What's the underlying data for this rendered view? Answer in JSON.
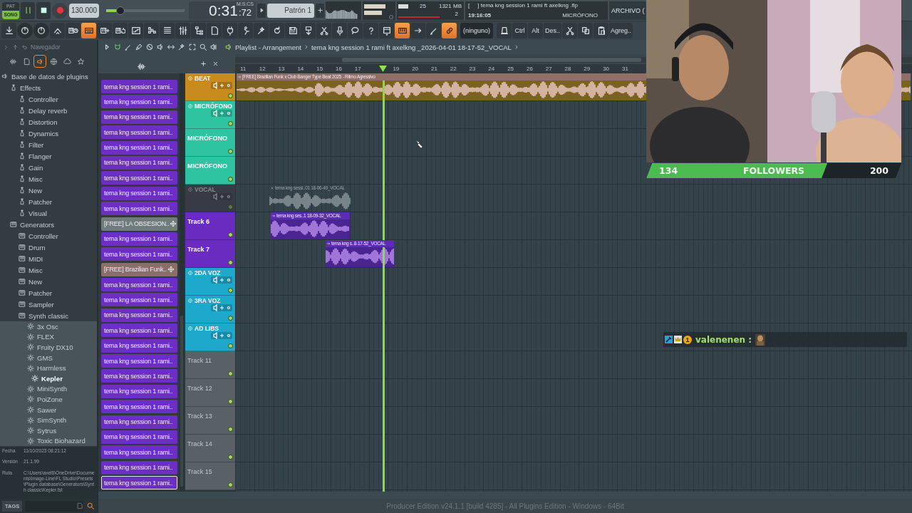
{
  "transport": {
    "modes": [
      {
        "label": "PAT",
        "selected": false
      },
      {
        "label": "SONG",
        "selected": true
      }
    ],
    "tempo": "130.000",
    "master_volume": {
      "level": 0.18
    },
    "time": "0:31",
    "time_fraction": ":72",
    "time_unit": "M:S:CS",
    "pattern": "Patrón 1",
    "cpu": "25",
    "memory": "1321 MB",
    "polyphony": "2",
    "hint": {
      "title": "[     ] tema kng session 1 rami ft axelkng .flp",
      "clock": "19:16:05",
      "channel": "MICRÓFONO"
    },
    "menu": "ARCHIVO ("
  },
  "toolbar": [
    {
      "kind": "download",
      "on": false
    },
    {
      "kind": "knob",
      "on": false
    },
    {
      "kind": "knob",
      "on": false
    },
    {
      "kind": "arrows",
      "on": false
    },
    {
      "kind": "piano-clock",
      "on": false
    },
    {
      "kind": "typing",
      "on": true
    },
    {
      "kind": "piano-plus",
      "on": false
    },
    {
      "kind": "piano-loop",
      "on": false
    },
    {
      "kind": "roll",
      "on": false
    },
    {
      "kind": "steps",
      "on": false
    },
    {
      "kind": "rows",
      "on": false
    },
    {
      "kind": "mixer",
      "on": false
    },
    {
      "kind": "tree",
      "on": false
    },
    {
      "kind": "file",
      "on": false
    },
    {
      "kind": "plug",
      "on": false
    },
    {
      "kind": "person",
      "on": false
    },
    {
      "kind": "wand",
      "on": false
    },
    {
      "kind": "refresh",
      "on": false
    },
    {
      "kind": "save",
      "on": false
    },
    {
      "kind": "save-mix",
      "on": false
    },
    {
      "kind": "scissors",
      "on": false
    },
    {
      "kind": "mic",
      "on": false
    },
    {
      "kind": "chat",
      "on": false
    },
    {
      "kind": "help",
      "on": false
    },
    {
      "kind": "window",
      "on": false
    },
    {
      "kind": "piano",
      "on": true
    },
    {
      "kind": "arrow",
      "on": false
    },
    {
      "kind": "pen",
      "on": false
    },
    {
      "kind": "link",
      "on": true
    },
    {
      "kind": "field",
      "label": "(ninguno)",
      "on": false
    },
    {
      "kind": "hat",
      "on": false
    },
    {
      "kind": "text",
      "label": "Ctrl",
      "on": false
    },
    {
      "kind": "text",
      "label": "Alt",
      "on": false
    },
    {
      "kind": "text",
      "label": "Des..",
      "on": false
    },
    {
      "kind": "scissors",
      "on": false
    },
    {
      "kind": "copy",
      "on": false
    },
    {
      "kind": "paste",
      "on": false
    },
    {
      "kind": "text",
      "label": "Agreg..",
      "on": false
    }
  ],
  "browser": {
    "title": "Navegador",
    "tabs": [
      {
        "kind": "wave",
        "selected": false
      },
      {
        "kind": "file",
        "selected": false
      },
      {
        "kind": "speaker",
        "selected": true
      },
      {
        "kind": "globe",
        "selected": false
      },
      {
        "kind": "cloud",
        "selected": false
      },
      {
        "kind": "star",
        "selected": false
      }
    ],
    "tree": [
      {
        "label": "Base de datos de plugins",
        "selected": false,
        "children": [
          {
            "label": "Effects",
            "selected": false,
            "children": [
              {
                "label": "Controller",
                "selected": false
              },
              {
                "label": "Delay reverb",
                "selected": false
              },
              {
                "label": "Distortion",
                "selected": false
              },
              {
                "label": "Dynamics",
                "selected": false
              },
              {
                "label": "Filter",
                "selected": false
              },
              {
                "label": "Flanger",
                "selected": false
              },
              {
                "label": "Gain",
                "selected": false
              },
              {
                "label": "Misc",
                "selected": false
              },
              {
                "label": "New",
                "selected": false
              },
              {
                "label": "Patcher",
                "selected": false
              },
              {
                "label": "Visual",
                "selected": false
              }
            ]
          },
          {
            "label": "Generators",
            "selected": false,
            "children": [
              {
                "label": "Controller",
                "selected": false
              },
              {
                "label": "Drum",
                "selected": false
              },
              {
                "label": "MIDI",
                "selected": false
              },
              {
                "label": "Misc",
                "selected": false
              },
              {
                "label": "New",
                "selected": false
              },
              {
                "label": "Patcher",
                "selected": false
              },
              {
                "label": "Sampler",
                "selected": false
              },
              {
                "label": "Synth classic",
                "selected": false,
                "children": [
                  {
                    "label": "3x Osc",
                    "selected": false
                  },
                  {
                    "label": "FLEX",
                    "selected": false
                  },
                  {
                    "label": "Fruity DX10",
                    "selected": false
                  },
                  {
                    "label": "GMS",
                    "selected": false
                  },
                  {
                    "label": "Harmless",
                    "selected": false
                  },
                  {
                    "label": "Kepler",
                    "selected": true
                  },
                  {
                    "label": "MiniSynth",
                    "selected": false
                  },
                  {
                    "label": "PoiZone",
                    "selected": false
                  },
                  {
                    "label": "Sawer",
                    "selected": false
                  },
                  {
                    "label": "SimSynth",
                    "selected": false
                  },
                  {
                    "label": "Sytrus",
                    "selected": false
                  },
                  {
                    "label": "Toxic Biohazard",
                    "selected": false
                  }
                ]
              }
            ]
          }
        ]
      }
    ],
    "info": [
      {
        "label": "Fecha",
        "value": "11/10/2023 08:21:12"
      },
      {
        "label": "Versión",
        "value": "21.1.99"
      },
      {
        "label": "Ruta",
        "value": "C:\\Users\\axel6\\OneDrive\\Documents\\Image-Line\\FL Studio\\Presets\\Plugin database\\Generators\\Synth classic\\Kepler.fst"
      }
    ],
    "tags": "TAGS"
  },
  "playlist": {
    "tools": [
      {
        "kind": "play",
        "on": false
      },
      {
        "kind": "magnet",
        "on": true
      },
      {
        "kind": "pen",
        "on": false
      },
      {
        "kind": "paint",
        "on": false
      },
      {
        "kind": "mute",
        "on": false
      },
      {
        "kind": "speaker",
        "on": false
      },
      {
        "kind": "slide",
        "on": false
      },
      {
        "kind": "wand",
        "on": false
      },
      {
        "kind": "select",
        "on": false
      },
      {
        "kind": "zoom",
        "on": false
      },
      {
        "kind": "volume",
        "on": false
      }
    ],
    "title": "Playlist - Arrangement",
    "breadcrumb": "tema kng session 1 rami ft axelkng _2026-04-01 18-17-52_VOCAL",
    "patterns": [
      {
        "label": "tema kng session 1 rami..",
        "kind": "audio",
        "color": "#6b2fc4",
        "selected": false
      },
      {
        "label": "tema kng session 1 rami..",
        "kind": "audio",
        "color": "#6b2fc4",
        "selected": false
      },
      {
        "label": "tema kng session 1 rami..",
        "kind": "audio",
        "color": "#6b2fc4",
        "selected": false
      },
      {
        "label": "tema kng session 1 rami..",
        "kind": "audio",
        "color": "#6b2fc4",
        "selected": false
      },
      {
        "label": "tema kng session 1 rami..",
        "kind": "audio",
        "color": "#6b2fc4",
        "selected": false
      },
      {
        "label": "tema kng session 1 rami..",
        "kind": "audio",
        "color": "#6b2fc4",
        "selected": false
      },
      {
        "label": "tema kng session 1 rami..",
        "kind": "audio",
        "color": "#6b2fc4",
        "selected": false
      },
      {
        "label": "tema kng session 1 rami..",
        "kind": "audio",
        "color": "#6b2fc4",
        "selected": false
      },
      {
        "label": "tema kng session 1 rami..",
        "kind": "audio",
        "color": "#6b2fc4",
        "selected": false
      },
      {
        "label": "[FREE] LA OBSESION..",
        "kind": "sample",
        "color": "#6f7c79",
        "selected": false
      },
      {
        "label": "tema kng session 1 rami..",
        "kind": "audio",
        "color": "#6b2fc4",
        "selected": false
      },
      {
        "label": "tema kng session 1 rami..",
        "kind": "audio",
        "color": "#6b2fc4",
        "selected": false
      },
      {
        "label": "[FREE] Brazilian Funk..",
        "kind": "sample",
        "color": "#8a6f68",
        "selected": false
      },
      {
        "label": "tema kng session 1 rami..",
        "kind": "audio",
        "color": "#6b2fc4",
        "selected": false
      },
      {
        "label": "tema kng session 1 rami..",
        "kind": "audio",
        "color": "#6b2fc4",
        "selected": false
      },
      {
        "label": "tema kng session 1 rami..",
        "kind": "audio",
        "color": "#6b2fc4",
        "selected": false
      },
      {
        "label": "tema kng session 1 rami..",
        "kind": "audio",
        "color": "#6b2fc4",
        "selected": false
      },
      {
        "label": "tema kng session 1 rami..",
        "kind": "audio",
        "color": "#6b2fc4",
        "selected": false
      },
      {
        "label": "tema kng session 1 rami..",
        "kind": "audio",
        "color": "#6b2fc4",
        "selected": false
      },
      {
        "label": "tema kng session 1 rami..",
        "kind": "audio",
        "color": "#6b2fc4",
        "selected": false
      },
      {
        "label": "tema kng session 1 rami..",
        "kind": "audio",
        "color": "#6b2fc4",
        "selected": false
      },
      {
        "label": "tema kng session 1 rami..",
        "kind": "audio",
        "color": "#6b2fc4",
        "selected": false
      },
      {
        "label": "tema kng session 1 rami..",
        "kind": "audio",
        "color": "#6b2fc4",
        "selected": false
      },
      {
        "label": "tema kng session 1 rami..",
        "kind": "audio",
        "color": "#6b2fc4",
        "selected": false
      },
      {
        "label": "tema kng session 1 rami..",
        "kind": "audio",
        "color": "#6b2fc4",
        "selected": false
      },
      {
        "label": "tema kng session 1 rami..",
        "kind": "audio",
        "color": "#6b2fc4",
        "selected": false
      },
      {
        "label": "tema kng session 1 rami..",
        "kind": "audio",
        "color": "#6b2fc4",
        "selected": true
      }
    ],
    "ruler": [
      {
        "kind": "bar",
        "label": "11"
      },
      {
        "kind": "bar",
        "label": "12"
      },
      {
        "kind": "bar",
        "label": "13"
      },
      {
        "kind": "bar",
        "label": "14"
      },
      {
        "kind": "bar",
        "label": "15"
      },
      {
        "kind": "bar",
        "label": "16"
      },
      {
        "kind": "bar",
        "label": "17"
      },
      {
        "kind": "playhead"
      },
      {
        "kind": "bar",
        "label": "19"
      },
      {
        "kind": "bar",
        "label": "20"
      },
      {
        "kind": "bar",
        "label": "21"
      },
      {
        "kind": "bar",
        "label": "22"
      },
      {
        "kind": "bar",
        "label": "23"
      },
      {
        "kind": "bar",
        "label": "24"
      },
      {
        "kind": "bar",
        "label": "25"
      },
      {
        "kind": "bar",
        "label": "26"
      },
      {
        "kind": "bar",
        "label": "27"
      },
      {
        "kind": "bar",
        "label": "28"
      },
      {
        "kind": "bar",
        "label": "29"
      },
      {
        "kind": "bar",
        "label": "30"
      },
      {
        "kind": "bar",
        "label": "31"
      }
    ],
    "tracks": [
      {
        "name": "BEAT",
        "kind": "full",
        "color": "#c98a1e",
        "muted": false,
        "clips": [
          {
            "label": "[FREE] Brazilian Funk x Club Banger Type Beat 2025 - Ritmo Agressivo",
            "muted": false
          }
        ]
      },
      {
        "name": "MICRÓFONO",
        "kind": "full",
        "color": "#2ec4a2",
        "muted": false
      },
      {
        "name": "MICRÓFONO",
        "kind": "plain",
        "color": "#2ec4a2",
        "muted": false
      },
      {
        "name": "MICRÓFONO",
        "kind": "plain",
        "color": "#2ec4a2",
        "muted": false
      },
      {
        "name": "VOCAL",
        "kind": "full",
        "color": "#4a4458",
        "muted": true,
        "clips": [
          {
            "label": "tema kng sessi..01 18-06-49_VOCAL",
            "muted": true
          }
        ]
      },
      {
        "name": "Track 6",
        "kind": "plain",
        "color": "#6a2cc0",
        "muted": false,
        "clips": [
          {
            "label": "tema kng ses..1 18-09-32_VOCAL",
            "muted": false
          }
        ]
      },
      {
        "name": "Track 7",
        "kind": "plain",
        "color": "#6a2cc0",
        "muted": false,
        "clips": [
          {
            "label": "tema kng s..8-17-52_VOCAL",
            "muted": false
          }
        ]
      },
      {
        "name": "2DA VOZ",
        "kind": "full",
        "color": "#1ea9cc",
        "muted": false
      },
      {
        "name": "3RA VOZ",
        "kind": "full",
        "color": "#1ea9cc",
        "muted": false
      },
      {
        "name": "AD LIBS",
        "kind": "full",
        "color": "#1ea9cc",
        "muted": false
      },
      {
        "name": "Track 11",
        "kind": "plain",
        "color": "#596166",
        "muted": false
      },
      {
        "name": "Track 12",
        "kind": "plain",
        "color": "#596166",
        "muted": false
      },
      {
        "name": "Track 13",
        "kind": "plain",
        "color": "#596166",
        "muted": false
      },
      {
        "name": "Track 14",
        "kind": "plain",
        "color": "#596166",
        "muted": false
      },
      {
        "name": "Track 15",
        "kind": "plain",
        "color": "#596166",
        "muted": false
      }
    ]
  },
  "followers": {
    "current": "134",
    "label": "FOLLOWERS",
    "goal": "200",
    "level": 0.71
  },
  "chat": {
    "badge": "1",
    "user": "valenenen :"
  },
  "status": "Producer Edition v24.1.1 [build 4285] - All Plugins Edition - Windows - 64Bit"
}
